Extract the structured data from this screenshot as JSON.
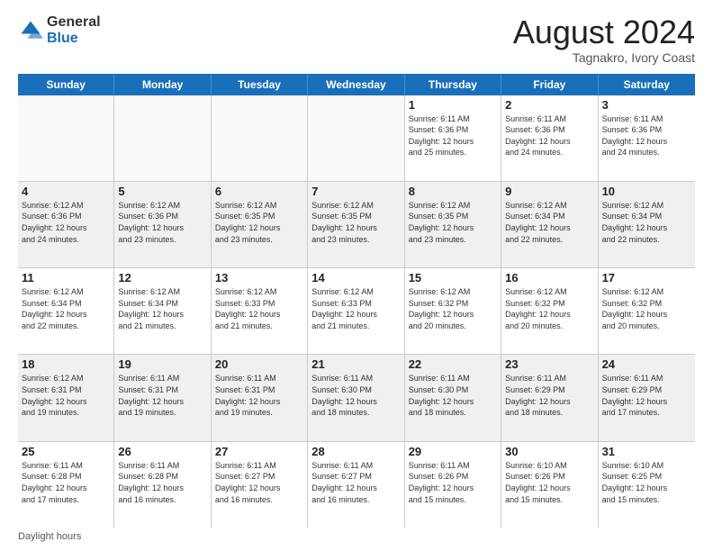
{
  "header": {
    "logo_general": "General",
    "logo_blue": "Blue",
    "title": "August 2024",
    "subtitle": "Tagnakro, Ivory Coast"
  },
  "days_of_week": [
    "Sunday",
    "Monday",
    "Tuesday",
    "Wednesday",
    "Thursday",
    "Friday",
    "Saturday"
  ],
  "weeks": [
    [
      {
        "day": "",
        "info": "",
        "empty": true
      },
      {
        "day": "",
        "info": "",
        "empty": true
      },
      {
        "day": "",
        "info": "",
        "empty": true
      },
      {
        "day": "",
        "info": "",
        "empty": true
      },
      {
        "day": "1",
        "info": "Sunrise: 6:11 AM\nSunset: 6:36 PM\nDaylight: 12 hours\nand 25 minutes.",
        "empty": false
      },
      {
        "day": "2",
        "info": "Sunrise: 6:11 AM\nSunset: 6:36 PM\nDaylight: 12 hours\nand 24 minutes.",
        "empty": false
      },
      {
        "day": "3",
        "info": "Sunrise: 6:11 AM\nSunset: 6:36 PM\nDaylight: 12 hours\nand 24 minutes.",
        "empty": false
      }
    ],
    [
      {
        "day": "4",
        "info": "Sunrise: 6:12 AM\nSunset: 6:36 PM\nDaylight: 12 hours\nand 24 minutes.",
        "empty": false
      },
      {
        "day": "5",
        "info": "Sunrise: 6:12 AM\nSunset: 6:36 PM\nDaylight: 12 hours\nand 23 minutes.",
        "empty": false
      },
      {
        "day": "6",
        "info": "Sunrise: 6:12 AM\nSunset: 6:35 PM\nDaylight: 12 hours\nand 23 minutes.",
        "empty": false
      },
      {
        "day": "7",
        "info": "Sunrise: 6:12 AM\nSunset: 6:35 PM\nDaylight: 12 hours\nand 23 minutes.",
        "empty": false
      },
      {
        "day": "8",
        "info": "Sunrise: 6:12 AM\nSunset: 6:35 PM\nDaylight: 12 hours\nand 23 minutes.",
        "empty": false
      },
      {
        "day": "9",
        "info": "Sunrise: 6:12 AM\nSunset: 6:34 PM\nDaylight: 12 hours\nand 22 minutes.",
        "empty": false
      },
      {
        "day": "10",
        "info": "Sunrise: 6:12 AM\nSunset: 6:34 PM\nDaylight: 12 hours\nand 22 minutes.",
        "empty": false
      }
    ],
    [
      {
        "day": "11",
        "info": "Sunrise: 6:12 AM\nSunset: 6:34 PM\nDaylight: 12 hours\nand 22 minutes.",
        "empty": false
      },
      {
        "day": "12",
        "info": "Sunrise: 6:12 AM\nSunset: 6:34 PM\nDaylight: 12 hours\nand 21 minutes.",
        "empty": false
      },
      {
        "day": "13",
        "info": "Sunrise: 6:12 AM\nSunset: 6:33 PM\nDaylight: 12 hours\nand 21 minutes.",
        "empty": false
      },
      {
        "day": "14",
        "info": "Sunrise: 6:12 AM\nSunset: 6:33 PM\nDaylight: 12 hours\nand 21 minutes.",
        "empty": false
      },
      {
        "day": "15",
        "info": "Sunrise: 6:12 AM\nSunset: 6:32 PM\nDaylight: 12 hours\nand 20 minutes.",
        "empty": false
      },
      {
        "day": "16",
        "info": "Sunrise: 6:12 AM\nSunset: 6:32 PM\nDaylight: 12 hours\nand 20 minutes.",
        "empty": false
      },
      {
        "day": "17",
        "info": "Sunrise: 6:12 AM\nSunset: 6:32 PM\nDaylight: 12 hours\nand 20 minutes.",
        "empty": false
      }
    ],
    [
      {
        "day": "18",
        "info": "Sunrise: 6:12 AM\nSunset: 6:31 PM\nDaylight: 12 hours\nand 19 minutes.",
        "empty": false
      },
      {
        "day": "19",
        "info": "Sunrise: 6:11 AM\nSunset: 6:31 PM\nDaylight: 12 hours\nand 19 minutes.",
        "empty": false
      },
      {
        "day": "20",
        "info": "Sunrise: 6:11 AM\nSunset: 6:31 PM\nDaylight: 12 hours\nand 19 minutes.",
        "empty": false
      },
      {
        "day": "21",
        "info": "Sunrise: 6:11 AM\nSunset: 6:30 PM\nDaylight: 12 hours\nand 18 minutes.",
        "empty": false
      },
      {
        "day": "22",
        "info": "Sunrise: 6:11 AM\nSunset: 6:30 PM\nDaylight: 12 hours\nand 18 minutes.",
        "empty": false
      },
      {
        "day": "23",
        "info": "Sunrise: 6:11 AM\nSunset: 6:29 PM\nDaylight: 12 hours\nand 18 minutes.",
        "empty": false
      },
      {
        "day": "24",
        "info": "Sunrise: 6:11 AM\nSunset: 6:29 PM\nDaylight: 12 hours\nand 17 minutes.",
        "empty": false
      }
    ],
    [
      {
        "day": "25",
        "info": "Sunrise: 6:11 AM\nSunset: 6:28 PM\nDaylight: 12 hours\nand 17 minutes.",
        "empty": false
      },
      {
        "day": "26",
        "info": "Sunrise: 6:11 AM\nSunset: 6:28 PM\nDaylight: 12 hours\nand 16 minutes.",
        "empty": false
      },
      {
        "day": "27",
        "info": "Sunrise: 6:11 AM\nSunset: 6:27 PM\nDaylight: 12 hours\nand 16 minutes.",
        "empty": false
      },
      {
        "day": "28",
        "info": "Sunrise: 6:11 AM\nSunset: 6:27 PM\nDaylight: 12 hours\nand 16 minutes.",
        "empty": false
      },
      {
        "day": "29",
        "info": "Sunrise: 6:11 AM\nSunset: 6:26 PM\nDaylight: 12 hours\nand 15 minutes.",
        "empty": false
      },
      {
        "day": "30",
        "info": "Sunrise: 6:10 AM\nSunset: 6:26 PM\nDaylight: 12 hours\nand 15 minutes.",
        "empty": false
      },
      {
        "day": "31",
        "info": "Sunrise: 6:10 AM\nSunset: 6:25 PM\nDaylight: 12 hours\nand 15 minutes.",
        "empty": false
      }
    ]
  ],
  "footer": {
    "note": "Daylight hours"
  },
  "colors": {
    "header_bg": "#1a6fba",
    "shaded_row": "#f0f0f0"
  }
}
